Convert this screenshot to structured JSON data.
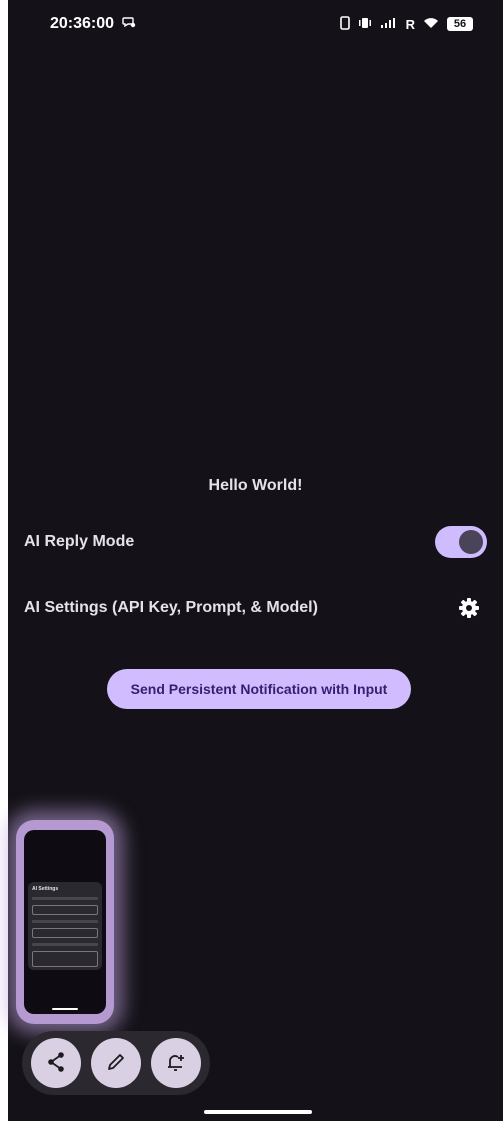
{
  "status_bar": {
    "time": "20:36:00",
    "network_label": "R",
    "battery": "56"
  },
  "main": {
    "greeting": "Hello World!",
    "ai_reply_mode": {
      "label": "AI Reply Mode",
      "enabled": true
    },
    "ai_settings": {
      "label": "AI Settings (API Key, Prompt, & Model)",
      "icon": "gear-icon"
    },
    "notify_button_label": "Send Persistent Notification with Input"
  },
  "screenshot_preview": {
    "dialog_title": "AI Settings"
  },
  "floating_actions": [
    {
      "name": "share",
      "icon": "share-icon"
    },
    {
      "name": "edit",
      "icon": "pencil-icon"
    },
    {
      "name": "add-reminder",
      "icon": "bell-plus-icon"
    }
  ],
  "colors": {
    "background": "#141218",
    "accent": "#d0bcff",
    "accent_text": "#381e72",
    "switch_thumb": "#4a4458",
    "fab": "#d9d0e4"
  }
}
